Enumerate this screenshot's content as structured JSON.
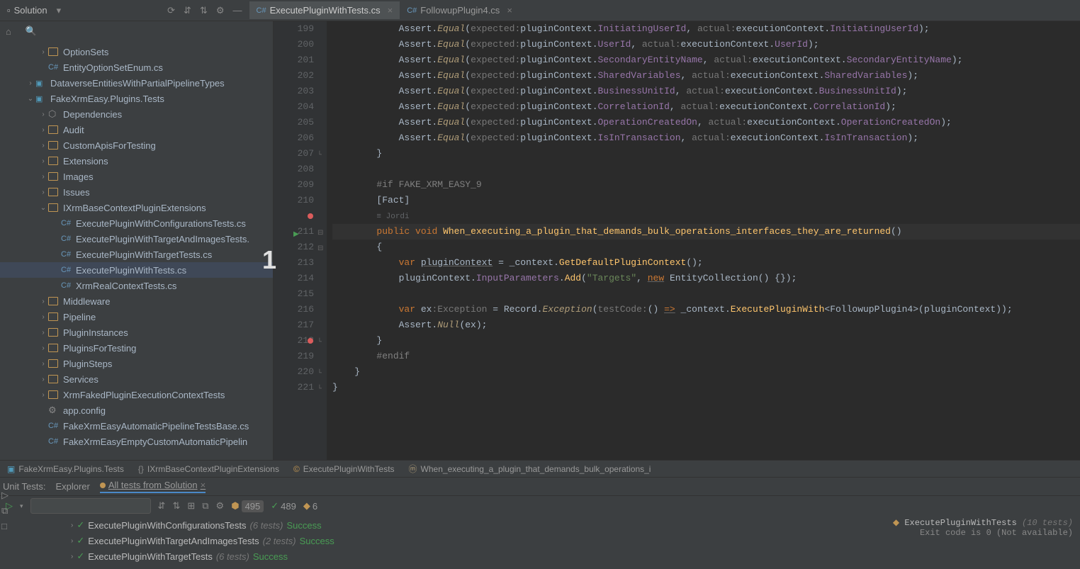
{
  "topbar": {
    "solution_label": "Solution",
    "tabs": [
      {
        "name": "ExecutePluginWithTests.cs",
        "badge": "C#",
        "active": true
      },
      {
        "name": "FollowupPlugin4.cs",
        "badge": "C#",
        "active": false
      }
    ]
  },
  "tree": [
    {
      "indent": 3,
      "chev": "›",
      "icon": "folder",
      "label": "OptionSets"
    },
    {
      "indent": 3,
      "chev": "",
      "icon": "cs",
      "label": "EntityOptionSetEnum.cs"
    },
    {
      "indent": 2,
      "chev": "›",
      "icon": "proj",
      "label": "DataverseEntitiesWithPartialPipelineTypes"
    },
    {
      "indent": 2,
      "chev": "⌄",
      "icon": "proj",
      "label": "FakeXrmEasy.Plugins.Tests"
    },
    {
      "indent": 3,
      "chev": "›",
      "icon": "dep",
      "label": "Dependencies"
    },
    {
      "indent": 3,
      "chev": "›",
      "icon": "folder",
      "label": "Audit"
    },
    {
      "indent": 3,
      "chev": "›",
      "icon": "folder",
      "label": "CustomApisForTesting"
    },
    {
      "indent": 3,
      "chev": "›",
      "icon": "folder",
      "label": "Extensions"
    },
    {
      "indent": 3,
      "chev": "›",
      "icon": "folder",
      "label": "Images"
    },
    {
      "indent": 3,
      "chev": "›",
      "icon": "folder",
      "label": "Issues"
    },
    {
      "indent": 3,
      "chev": "⌄",
      "icon": "folder",
      "label": "IXrmBaseContextPluginExtensions"
    },
    {
      "indent": 4,
      "chev": "",
      "icon": "cs",
      "label": "ExecutePluginWithConfigurationsTests.cs"
    },
    {
      "indent": 4,
      "chev": "",
      "icon": "cs",
      "label": "ExecutePluginWithTargetAndImagesTests."
    },
    {
      "indent": 4,
      "chev": "",
      "icon": "cs",
      "label": "ExecutePluginWithTargetTests.cs"
    },
    {
      "indent": 4,
      "chev": "",
      "icon": "cs",
      "label": "ExecutePluginWithTests.cs",
      "selected": true
    },
    {
      "indent": 4,
      "chev": "",
      "icon": "cs",
      "label": "XrmRealContextTests.cs"
    },
    {
      "indent": 3,
      "chev": "›",
      "icon": "folder",
      "label": "Middleware"
    },
    {
      "indent": 3,
      "chev": "›",
      "icon": "folder",
      "label": "Pipeline"
    },
    {
      "indent": 3,
      "chev": "›",
      "icon": "folder",
      "label": "PluginInstances"
    },
    {
      "indent": 3,
      "chev": "›",
      "icon": "folder",
      "label": "PluginsForTesting"
    },
    {
      "indent": 3,
      "chev": "›",
      "icon": "folder",
      "label": "PluginSteps"
    },
    {
      "indent": 3,
      "chev": "›",
      "icon": "folder",
      "label": "Services"
    },
    {
      "indent": 3,
      "chev": "›",
      "icon": "folder",
      "label": "XrmFakedPluginExecutionContextTests"
    },
    {
      "indent": 3,
      "chev": "",
      "icon": "cfg",
      "label": "app.config"
    },
    {
      "indent": 3,
      "chev": "",
      "icon": "cs",
      "label": "FakeXrmEasyAutomaticPipelineTestsBase.cs"
    },
    {
      "indent": 3,
      "chev": "",
      "icon": "cs",
      "label": "FakeXrmEasyEmptyCustomAutomaticPipelin"
    }
  ],
  "gutter_lines": [
    "199",
    "200",
    "201",
    "202",
    "203",
    "204",
    "205",
    "206",
    "207",
    "208",
    "209",
    "210",
    "",
    "211",
    "212",
    "213",
    "214",
    "215",
    "216",
    "217",
    "218",
    "219",
    "220",
    "221"
  ],
  "breakpoints": [
    12,
    20
  ],
  "run_marker_line": 13,
  "code": {
    "asserts": [
      {
        "p1": "InitiatingUserId",
        "p2": "InitiatingUserId"
      },
      {
        "p1": "UserId",
        "p2": "UserId"
      },
      {
        "p1": "SecondaryEntityName",
        "p2": "SecondaryEntityName"
      },
      {
        "p1": "SharedVariables",
        "p2": "SharedVariables"
      },
      {
        "p1": "BusinessUnitId",
        "p2": "BusinessUnitId"
      },
      {
        "p1": "CorrelationId",
        "p2": "CorrelationId"
      },
      {
        "p1": "OperationCreatedOn",
        "p2": "OperationCreatedOn"
      },
      {
        "p1": "IsInTransaction",
        "p2": "IsInTransaction"
      }
    ],
    "preproc_if": "#if FAKE_XRM_EASY_9",
    "fact_attr": "[Fact]",
    "author": "≡ Jordi",
    "method_sig": "public void When_executing_a_plugin_that_demands_bulk_operations_interfaces_they_are_returned()",
    "line_var": "var pluginContext = _context.GetDefaultPluginContext();",
    "line_add": "pluginContext.InputParameters.Add(\"Targets\", new EntityCollection() {});",
    "line_ex": "var ex:Exception = Record.Exception(testCode:() => _context.ExecutePluginWith<FollowupPlugin4>(pluginContext));",
    "line_null": "Assert.Null(ex);",
    "preproc_endif": "#endif"
  },
  "overlay": "1",
  "breadcrumb": [
    {
      "icon": "proj",
      "label": "FakeXrmEasy.Plugins.Tests"
    },
    {
      "icon": "ns",
      "label": "IXrmBaseContextPluginExtensions"
    },
    {
      "icon": "class",
      "label": "ExecutePluginWithTests"
    },
    {
      "icon": "method",
      "label": "When_executing_a_plugin_that_demands_bulk_operations_i"
    }
  ],
  "bottom": {
    "label": "Unit Tests:",
    "tabs": [
      "Explorer"
    ],
    "session": "All tests from Solution",
    "stats": {
      "total": "495",
      "passed": "489",
      "other": "6"
    },
    "tests": [
      {
        "name": "ExecutePluginWithConfigurationsTests",
        "meta": "(6 tests)",
        "status": "Success"
      },
      {
        "name": "ExecutePluginWithTargetAndImagesTests",
        "meta": "(2 tests)",
        "status": "Success"
      },
      {
        "name": "ExecutePluginWithTargetTests",
        "meta": "(6 tests)",
        "status": "Success"
      }
    ],
    "right_title": "ExecutePluginWithTests",
    "right_meta": "(10 tests)",
    "right_exit": "Exit code is 0 (Not available)"
  }
}
